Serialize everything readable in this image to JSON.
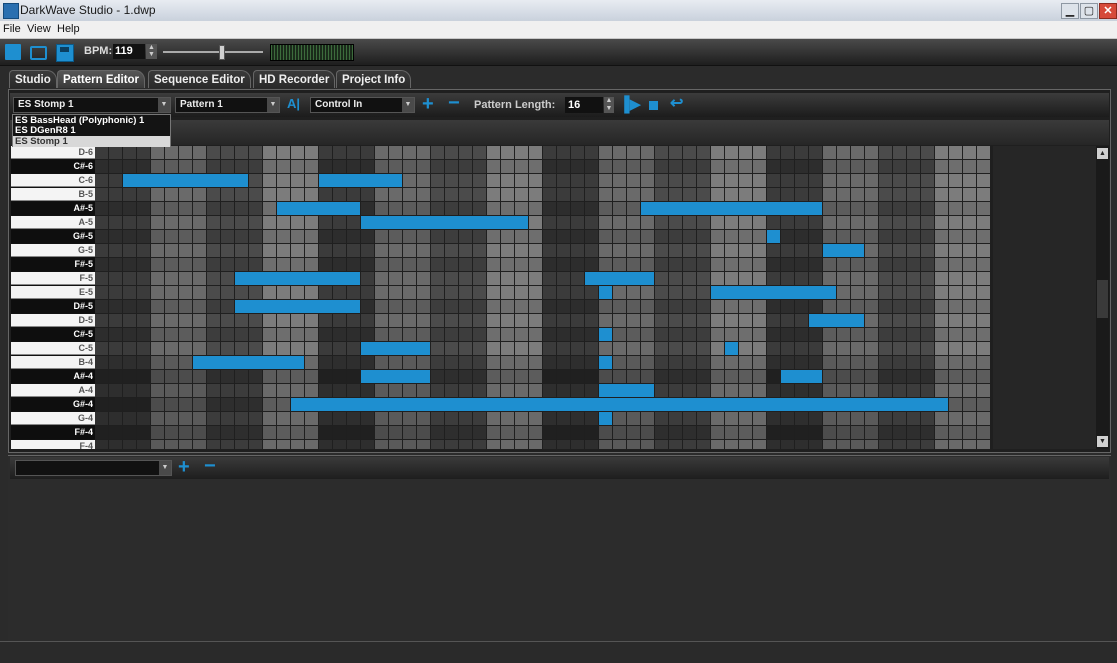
{
  "window": {
    "title": "DarkWave Studio - 1.dwp",
    "min": "▁",
    "max": "▢",
    "close": "✕"
  },
  "menu": [
    "File",
    "View",
    "Help"
  ],
  "toolbar": {
    "bpm_label": "BPM:",
    "bpm_value": "119",
    "bpm_slider_level": 0.57
  },
  "tabs": [
    "Studio",
    "Pattern Editor",
    "Sequence Editor",
    "HD Recorder",
    "Project Info"
  ],
  "active_tab": "Pattern Editor",
  "controls": {
    "instrument": "ES Stomp 1",
    "pattern": "Pattern 1",
    "control": "Control In",
    "pattern_length_label": "Pattern Length:",
    "pattern_length": "16"
  },
  "instrument_options": [
    "ES BassHead (Polyphonic) 1",
    "ES DGenR8 1",
    "ES Stomp 1"
  ],
  "keys": [
    "D-6",
    "C#-6",
    "C-6",
    "B-5",
    "A#-5",
    "A-5",
    "G#-5",
    "G-5",
    "F#-5",
    "F-5",
    "E-5",
    "D#-5",
    "D-5",
    "C#-5",
    "C-5",
    "B-4",
    "A#-4",
    "A-4",
    "G#-4",
    "G-4",
    "F#-4",
    "F-4"
  ],
  "notes": [
    {
      "row": "C-6",
      "start": 2,
      "len": 9
    },
    {
      "row": "C-6",
      "start": 16,
      "len": 6
    },
    {
      "row": "A#-5",
      "start": 13,
      "len": 6
    },
    {
      "row": "A#-5",
      "start": 39,
      "len": 13
    },
    {
      "row": "A-5",
      "start": 19,
      "len": 12
    },
    {
      "row": "G#-5",
      "start": 48,
      "len": 1
    },
    {
      "row": "G-5",
      "start": 52,
      "len": 3
    },
    {
      "row": "F-5",
      "start": 10,
      "len": 9
    },
    {
      "row": "F-5",
      "start": 35,
      "len": 5
    },
    {
      "row": "E-5",
      "start": 36,
      "len": 1
    },
    {
      "row": "E-5",
      "start": 44,
      "len": 9
    },
    {
      "row": "D#-5",
      "start": 10,
      "len": 9
    },
    {
      "row": "D-5",
      "start": 51,
      "len": 4
    },
    {
      "row": "C#-5",
      "start": 36,
      "len": 1
    },
    {
      "row": "C-5",
      "start": 19,
      "len": 5
    },
    {
      "row": "C-5",
      "start": 45,
      "len": 1
    },
    {
      "row": "B-4",
      "start": 7,
      "len": 8
    },
    {
      "row": "B-4",
      "start": 36,
      "len": 1
    },
    {
      "row": "A#-4",
      "start": 19,
      "len": 5
    },
    {
      "row": "A#-4",
      "start": 49,
      "len": 3
    },
    {
      "row": "A-4",
      "start": 36,
      "len": 4
    },
    {
      "row": "G#-4",
      "start": 14,
      "len": 47
    },
    {
      "row": "G-4",
      "start": 36,
      "len": 1
    }
  ],
  "colors": {
    "note": "#1e8fd0",
    "accent": "#1e8fd0"
  }
}
